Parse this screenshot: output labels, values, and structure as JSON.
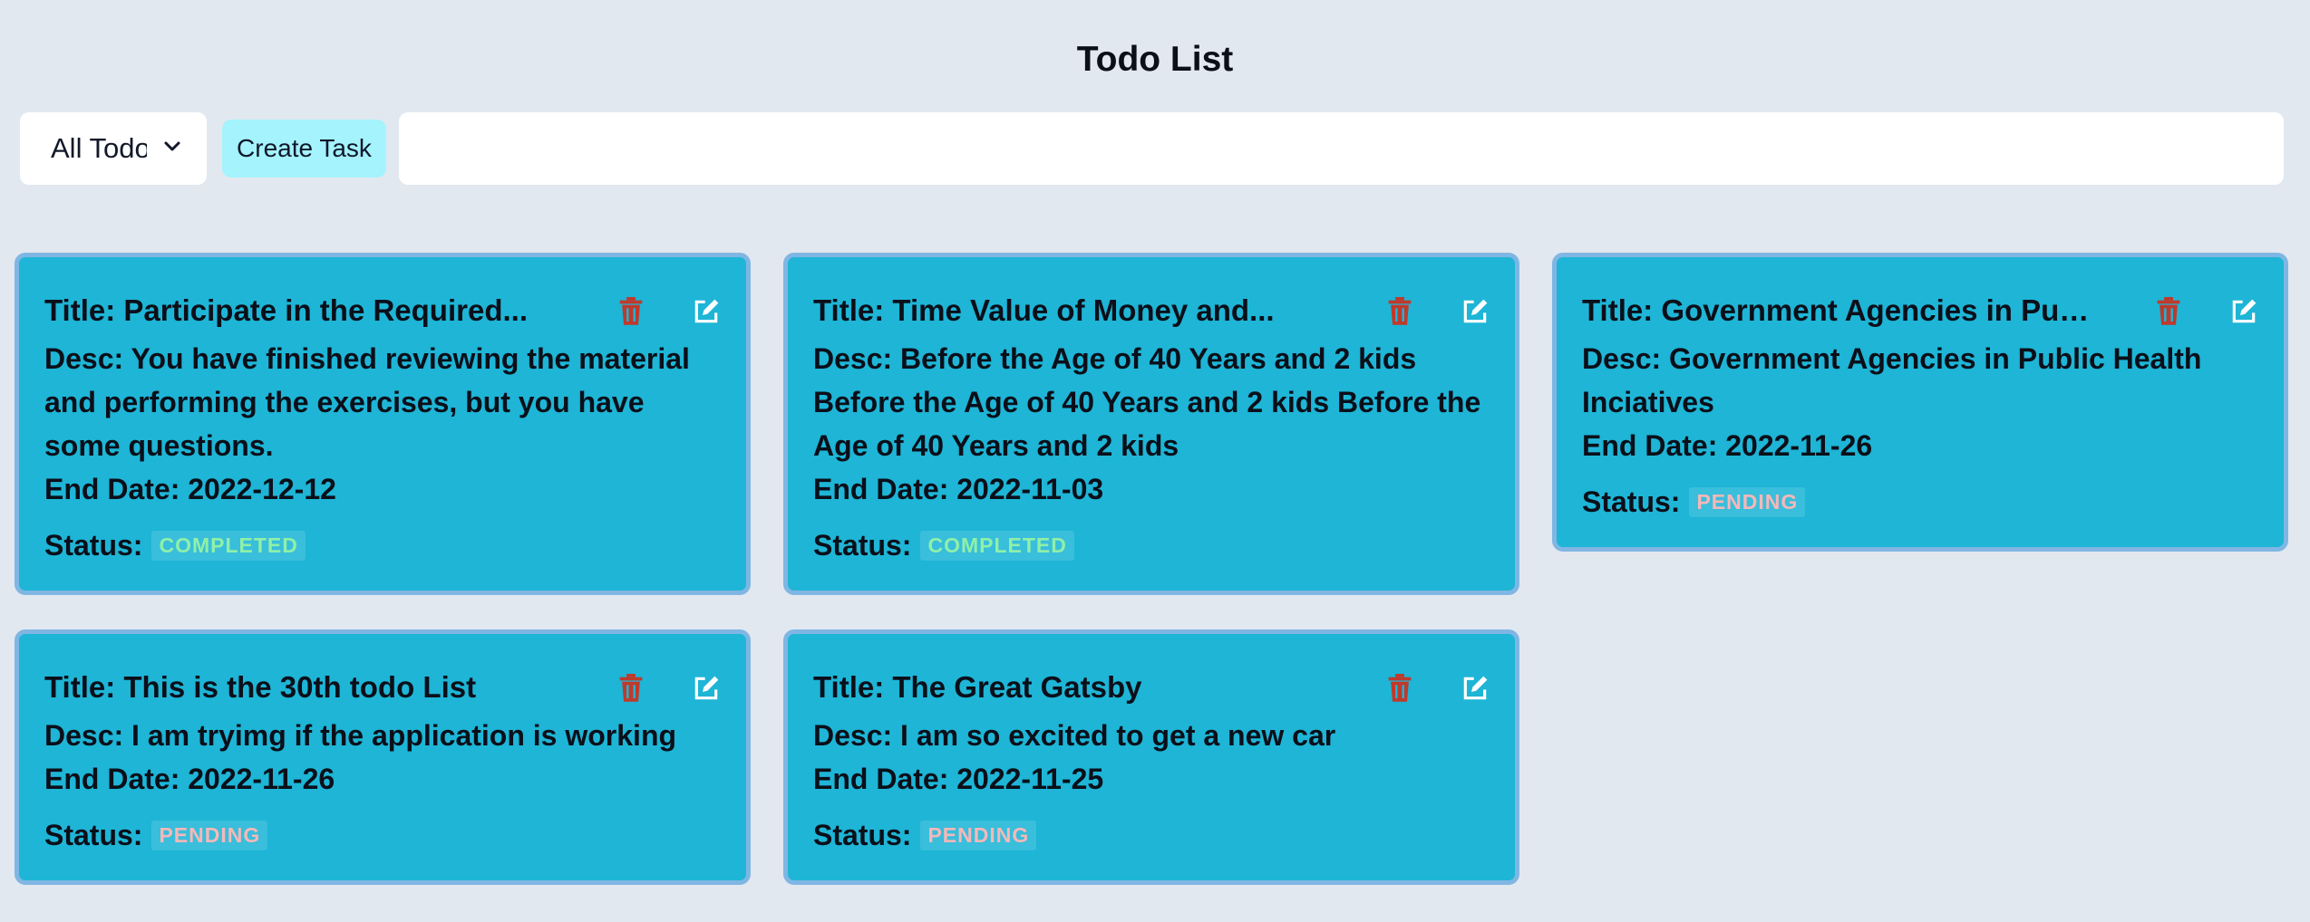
{
  "header": {
    "title": "Todo List"
  },
  "toolbar": {
    "filter_value": "All Todos",
    "create_label": "Create Task",
    "search_value": "",
    "search_placeholder": ""
  },
  "labels": {
    "title_prefix": "Title: ",
    "desc_prefix": "Desc: ",
    "end_prefix": "End Date: ",
    "status_prefix": "Status:"
  },
  "colors": {
    "background": "#e2e8f0",
    "card": "#1eb5d6",
    "card_border": "#7fb6e3",
    "create_button": "#a5f3fc",
    "delete_icon": "#c0392b",
    "completed_text": "#8ff0a8",
    "pending_text": "#f5b8b8"
  },
  "icons": {
    "delete": "trash-icon",
    "edit": "edit-icon",
    "dropdown": "chevron-down-icon"
  },
  "todos": [
    {
      "title": "Title: Participate in the Required...",
      "desc": "Desc: You have finished reviewing the material and performing the exercises, but you have some questions.",
      "end_date": "End Date: 2022-12-12",
      "status": "COMPLETED"
    },
    {
      "title": "Title: Time Value of Money and...",
      "desc": "Desc: Before the Age of 40 Years and 2 kids Before the Age of 40 Years and 2 kids Before the Age of 40 Years and 2 kids",
      "end_date": "End Date: 2022-11-03",
      "status": "COMPLETED"
    },
    {
      "title": "Title: Government Agencies in Publi...",
      "desc": "Desc: Government Agencies in Public Health Inciatives",
      "end_date": "End Date: 2022-11-26",
      "status": "PENDING"
    },
    {
      "title": "Title: This is the 30th todo List",
      "desc": "Desc: I am tryimg if the application is working",
      "end_date": "End Date: 2022-11-26",
      "status": "PENDING"
    },
    {
      "title": "Title: The Great Gatsby",
      "desc": "Desc: I am so excited to get a new car",
      "end_date": "End Date: 2022-11-25",
      "status": "PENDING"
    }
  ]
}
